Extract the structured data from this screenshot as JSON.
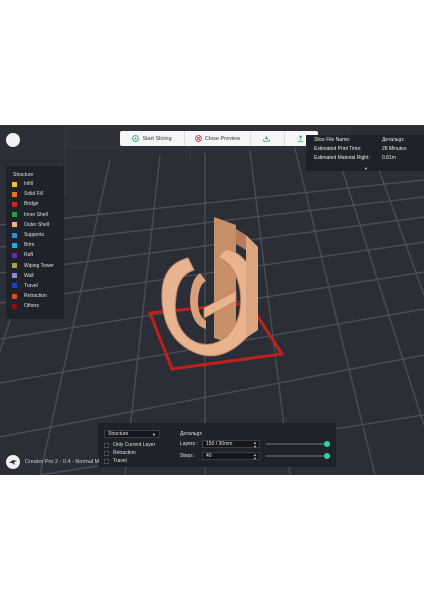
{
  "toolbar": {
    "start_slicing": "Start Slicing",
    "close_preview": "Close Preview",
    "export_icon": "export-icon",
    "upload_icon": "upload-icon"
  },
  "info_panel": {
    "rows": [
      {
        "label": "Slice File Name:",
        "value": "Детальgx"
      },
      {
        "label": "Estimated Print Time:",
        "value": "28 Minutes"
      },
      {
        "label": "Estimated Material Right:",
        "value": "0.81m"
      }
    ]
  },
  "structure": {
    "title": "Structure",
    "items": [
      {
        "label": "Infill",
        "color": "#f0c52b"
      },
      {
        "label": "Solid Fill",
        "color": "#e8741d"
      },
      {
        "label": "Bridge",
        "color": "#d82222"
      },
      {
        "label": "Inner Shell",
        "color": "#23a33a"
      },
      {
        "label": "Outer Shell",
        "color": "#f2b28a"
      },
      {
        "label": "Supports",
        "color": "#2f8fd8"
      },
      {
        "label": "Brim",
        "color": "#2aa6d8"
      },
      {
        "label": "Raft",
        "color": "#6b2ab0"
      },
      {
        "label": "Wiping Tower",
        "color": "#a8a05a"
      },
      {
        "label": "Wall",
        "color": "#8a8ad8"
      },
      {
        "label": "Travel",
        "color": "#1e3fd0"
      },
      {
        "label": "Retraction",
        "color": "#e24a1c"
      },
      {
        "label": "Others",
        "color": "#8a1010"
      }
    ]
  },
  "bottom_panel": {
    "view_select": "Structure",
    "options": [
      "Only Current Layer",
      "Retraction",
      "Travel"
    ],
    "file_name": "Детальgx",
    "layers_label": "Layers :",
    "layers_value": "150 / 30mm",
    "steps_label": "Steps :",
    "steps_value": "40",
    "layers_slider": 1.0,
    "steps_slider": 1.0
  },
  "printer": "Creator Pro 2 - 0.4 - Normal M",
  "colors": {
    "viewport_bg": "#2b2e36",
    "panel_bg": "#1f2229",
    "model": "#e8b48f",
    "bed_outline": "#c0201c",
    "accent": "#2ed3a8"
  }
}
